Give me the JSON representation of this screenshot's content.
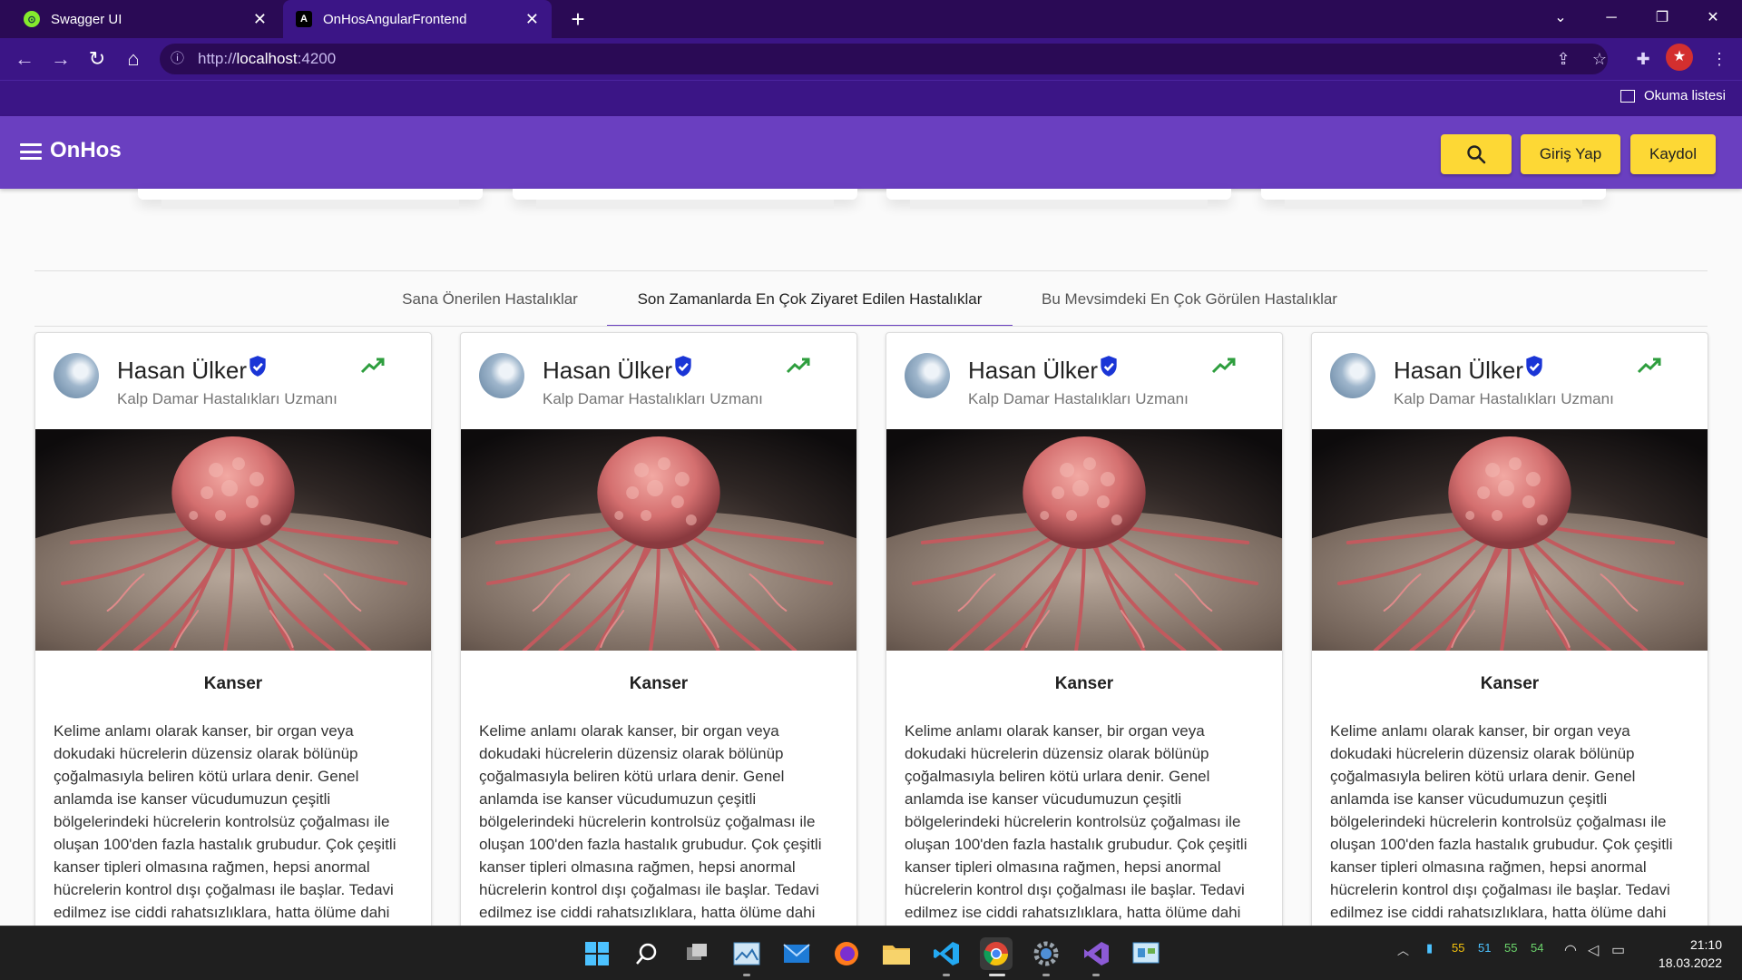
{
  "browser": {
    "tabs": [
      {
        "title": "Swagger UI",
        "favicon": "swagger-icon"
      },
      {
        "title": "OnHosAngularFrontend",
        "favicon": "angular-icon"
      }
    ],
    "url_prefix": "http://",
    "url_host": "localhost",
    "url_port": ":4200",
    "reading_list": "Okuma listesi"
  },
  "app": {
    "brand": "OnHos",
    "login_label": "Giriş Yap",
    "register_label": "Kaydol",
    "colors": {
      "primary": "#6a3fc0",
      "accent": "#fdd835",
      "verified": "#1a35d6",
      "trend": "#2e9e3e"
    }
  },
  "tabs": [
    {
      "label": "Sana Önerilen Hastalıklar",
      "active": false
    },
    {
      "label": "Son Zamanlarda En Çok Ziyaret Edilen Hastalıklar",
      "active": true
    },
    {
      "label": "Bu Mevsimdeki En Çok Görülen Hastalıklar",
      "active": false
    }
  ],
  "cards": [
    {
      "author": "Hasan Ülker",
      "specialty": "Kalp Damar Hastalıkları Uzmanı",
      "title": "Kanser",
      "text": "Kelime anlamı olarak kanser, bir organ veya dokudaki hücrelerin düzensiz olarak bölünüp çoğalmasıyla beliren kötü urlara denir. Genel anlamda ise kanser vücudumuzun çeşitli bölgelerindeki hücrelerin kontrolsüz çoğalması ile oluşan 100'den fazla hastalık grubudur. Çok çeşitli kanser tipleri olmasına rağmen, hepsi anormal hücrelerin kontrol dışı çoğalması ile başlar. Tedavi edilmez ise ciddi rahatsızlıklara, hatta ölüme dahi"
    },
    {
      "author": "Hasan Ülker",
      "specialty": "Kalp Damar Hastalıkları Uzmanı",
      "title": "Kanser",
      "text": "Kelime anlamı olarak kanser, bir organ veya dokudaki hücrelerin düzensiz olarak bölünüp çoğalmasıyla beliren kötü urlara denir. Genel anlamda ise kanser vücudumuzun çeşitli bölgelerindeki hücrelerin kontrolsüz çoğalması ile oluşan 100'den fazla hastalık grubudur. Çok çeşitli kanser tipleri olmasına rağmen, hepsi anormal hücrelerin kontrol dışı çoğalması ile başlar. Tedavi edilmez ise ciddi rahatsızlıklara, hatta ölüme dahi"
    },
    {
      "author": "Hasan Ülker",
      "specialty": "Kalp Damar Hastalıkları Uzmanı",
      "title": "Kanser",
      "text": "Kelime anlamı olarak kanser, bir organ veya dokudaki hücrelerin düzensiz olarak bölünüp çoğalmasıyla beliren kötü urlara denir. Genel anlamda ise kanser vücudumuzun çeşitli bölgelerindeki hücrelerin kontrolsüz çoğalması ile oluşan 100'den fazla hastalık grubudur. Çok çeşitli kanser tipleri olmasına rağmen, hepsi anormal hücrelerin kontrol dışı çoğalması ile başlar. Tedavi edilmez ise ciddi rahatsızlıklara, hatta ölüme dahi"
    },
    {
      "author": "Hasan Ülker",
      "specialty": "Kalp Damar Hastalıkları Uzmanı",
      "title": "Kanser",
      "text": "Kelime anlamı olarak kanser, bir organ veya dokudaki hücrelerin düzensiz olarak bölünüp çoğalmasıyla beliren kötü urlara denir. Genel anlamda ise kanser vücudumuzun çeşitli bölgelerindeki hücrelerin kontrolsüz çoğalması ile oluşan 100'den fazla hastalık grubudur. Çok çeşitli kanser tipleri olmasına rağmen, hepsi anormal hücrelerin kontrol dışı çoğalması ile başlar. Tedavi edilmez ise ciddi rahatsızlıklara, hatta ölüme dahi"
    }
  ],
  "taskbar": {
    "tray_numbers": [
      "55",
      "51",
      "55",
      "54"
    ],
    "time": "21:10",
    "date": "18.03.2022"
  }
}
